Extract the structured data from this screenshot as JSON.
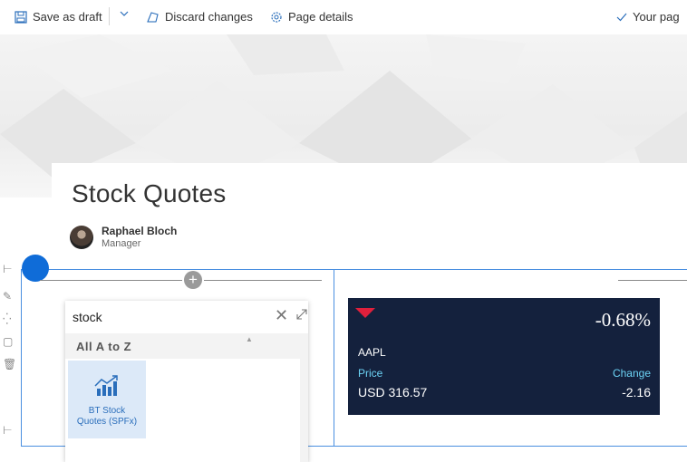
{
  "toolbar": {
    "save_label": "Save as draft",
    "discard_label": "Discard changes",
    "details_label": "Page details",
    "status_label": "Your pag"
  },
  "page": {
    "title": "Stock Quotes",
    "author": {
      "name": "Raphael Bloch",
      "role": "Manager"
    }
  },
  "toolbox": {
    "search_value": "stock",
    "category": "All A to Z",
    "tiles": [
      {
        "label_line1": "BT Stock",
        "label_line2": "Quotes (SPFx)",
        "icon": "stock-chart-icon"
      }
    ]
  },
  "stock": {
    "change_pct": "-0.68%",
    "symbol": "AAPL",
    "price_label": "Price",
    "change_label": "Change",
    "price_value": "USD 316.57",
    "change_value": "-2.16",
    "direction": "down",
    "colors": {
      "background": "#14213d",
      "down": "#e0203c",
      "label": "#6cd3f5"
    }
  },
  "colors": {
    "accent": "#0f6cd8",
    "selection": "#4a8fe0"
  }
}
